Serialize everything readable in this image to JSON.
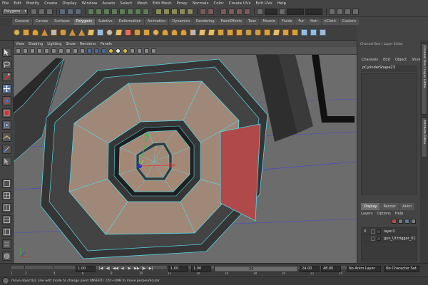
{
  "menubar": [
    "File",
    "Edit",
    "Modify",
    "Create",
    "Display",
    "Window",
    "Assets",
    "Select",
    "Mesh",
    "Edit Mesh",
    "Proxy",
    "Normals",
    "Color",
    "Create UVs",
    "Edit UVs",
    "Help"
  ],
  "statusline": {
    "mode": "Polygons"
  },
  "shelf_tabs": [
    {
      "label": "General",
      "active": false
    },
    {
      "label": "Curves",
      "active": false
    },
    {
      "label": "Surfaces",
      "active": false
    },
    {
      "label": "Polygons",
      "active": true
    },
    {
      "label": "Subdivs",
      "active": false
    },
    {
      "label": "Deformation",
      "active": false
    },
    {
      "label": "Animation",
      "active": false
    },
    {
      "label": "Dynamics",
      "active": false
    },
    {
      "label": "Rendering",
      "active": false
    },
    {
      "label": "PaintEffects",
      "active": false
    },
    {
      "label": "Toon",
      "active": false
    },
    {
      "label": "Muscle",
      "active": false
    },
    {
      "label": "Fluids",
      "active": false
    },
    {
      "label": "Fur",
      "active": false
    },
    {
      "label": "Hair",
      "active": false
    },
    {
      "label": "nCloth",
      "active": false
    },
    {
      "label": "Custom",
      "active": false
    }
  ],
  "viewport": {
    "menus": [
      "View",
      "Shading",
      "Lighting",
      "Show",
      "Renderer",
      "Panels"
    ]
  },
  "channel_box": {
    "title": "Channel Box / Layer Editor",
    "menus": [
      "Channels",
      "Edit",
      "Object",
      "Show"
    ],
    "object": "pCylinderShape23"
  },
  "layer_editor": {
    "tabs": [
      {
        "label": "Display",
        "active": true
      },
      {
        "label": "Render",
        "active": false
      },
      {
        "label": "Anim",
        "active": false
      }
    ],
    "menus": [
      "Layers",
      "Options",
      "Help"
    ],
    "layers": [
      {
        "visible": "V",
        "name": "layer1"
      },
      {
        "visible": "",
        "name": "gun_UI:trigger_01"
      }
    ]
  },
  "side_tabs": [
    "Channel Box / Layer Editor",
    "Attribute Editor"
  ],
  "timeline": {
    "ticks": [
      "1",
      "2",
      "4",
      "6",
      "8",
      "10",
      "12",
      "14",
      "16",
      "18",
      "20",
      "22",
      "24"
    ],
    "current_frame": "1.00"
  },
  "range": {
    "start": "1.00",
    "playback_start": "1.00",
    "range_label": "24",
    "playback_end": "24.00",
    "end": "48.00",
    "anim_layer": "No Anim Layer",
    "character_set": "No Character Set",
    "playback_buttons": [
      "|◀",
      "◀|",
      "◀◀",
      "◀",
      "▶",
      "▶▶",
      "|▶",
      "▶|"
    ]
  },
  "helpline": {
    "text": "move object(s). Use edit mode to change pivot (INSERT). Ctrl+LMB to move perpendicular."
  },
  "watermark": "",
  "colors": {
    "mesh_face": "#a48876",
    "mesh_selected_face": "#b04848",
    "mesh_dark": "#3e3e3e",
    "wire": "#5ad8e8",
    "accent_active_tab": "#6a6a6a"
  }
}
